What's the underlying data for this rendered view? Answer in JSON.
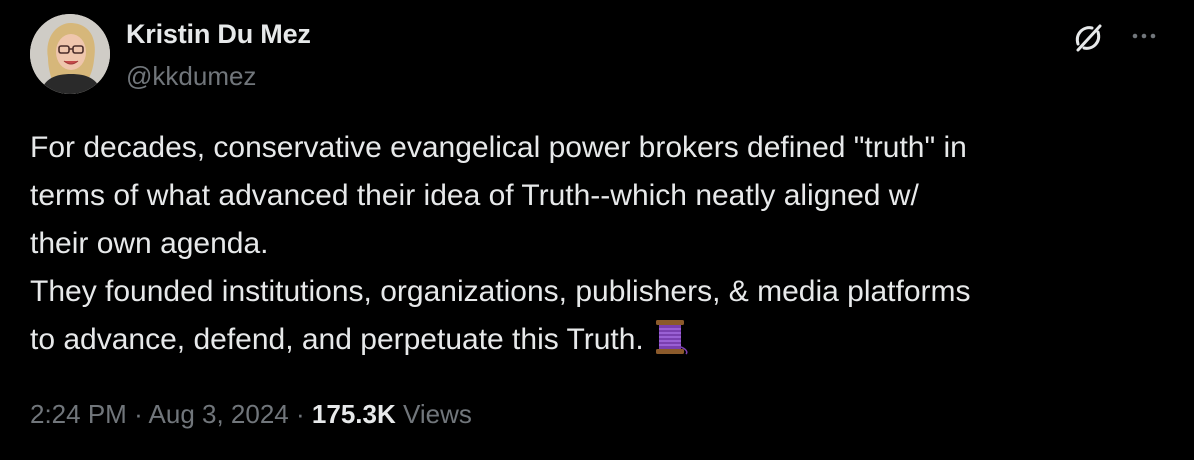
{
  "author": {
    "display_name": "Kristin Du Mez",
    "handle": "@kkdumez"
  },
  "icons": {
    "grok": "grok-icon",
    "more": "more-icon",
    "avatar": "avatar-photo",
    "emoji": "thread-spool-emoji"
  },
  "tweet": {
    "text": "For decades, conservative evangelical power brokers defined \"truth\" in\nterms of what advanced their idea of Truth--which neatly aligned w/\ntheir own agenda.\nThey founded institutions, organizations, publishers, & media platforms\nto advance, defend, and perpetuate this Truth."
  },
  "meta": {
    "time": "2:24 PM",
    "separator": "·",
    "date": "Aug 3, 2024",
    "views_count": "175.3K",
    "views_label": "Views"
  },
  "colors": {
    "background": "#000000",
    "text_primary": "#e7e9ea",
    "text_secondary": "#71767b"
  }
}
